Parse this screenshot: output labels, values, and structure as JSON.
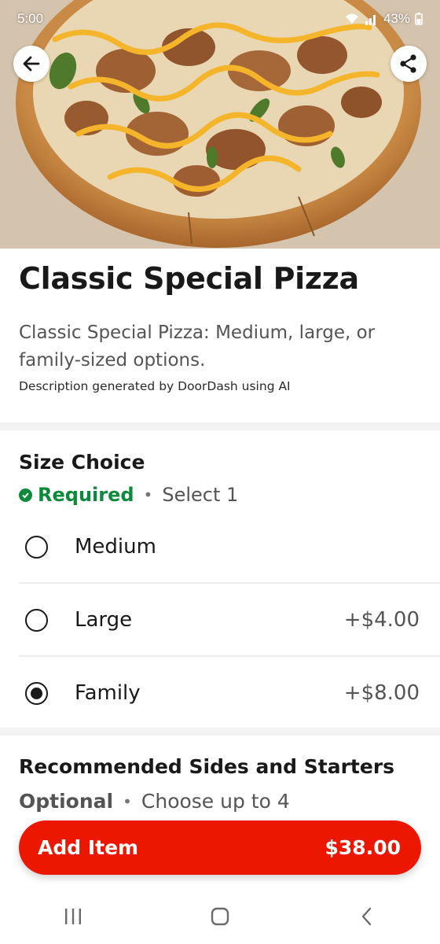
{
  "status_bar": {
    "time": "5:00",
    "battery": "43%",
    "icons": [
      "wifi-icon",
      "signal-icon",
      "battery-icon"
    ]
  },
  "hero": {
    "image": "pizza-photo",
    "back_icon": "arrow-left-icon",
    "share_icon": "share-icon"
  },
  "item": {
    "title": "Classic Special Pizza",
    "description": "Classic Special Pizza: Medium, large, or family-sized options.",
    "ai_note": "Description generated by DoorDash using AI"
  },
  "size_choice": {
    "title": "Size Choice",
    "required_label": "Required",
    "separator": "•",
    "select_label": "Select 1",
    "options": [
      {
        "label": "Medium",
        "price": "",
        "selected": false
      },
      {
        "label": "Large",
        "price": "+$4.00",
        "selected": false
      },
      {
        "label": "Family",
        "price": "+$8.00",
        "selected": true
      }
    ]
  },
  "sides": {
    "title": "Recommended Sides and Starters",
    "optional_label": "Optional",
    "separator": "•",
    "choose_label": "Choose up to 4"
  },
  "add_button": {
    "label": "Add Item",
    "price": "$38.00"
  },
  "nav_bar": {
    "icons": [
      "recent-apps-icon",
      "home-icon",
      "back-icon"
    ]
  },
  "colors": {
    "brand_red": "#eb1700",
    "required_green": "#0a8a3a",
    "text_primary": "#191919",
    "text_secondary": "#545454"
  }
}
